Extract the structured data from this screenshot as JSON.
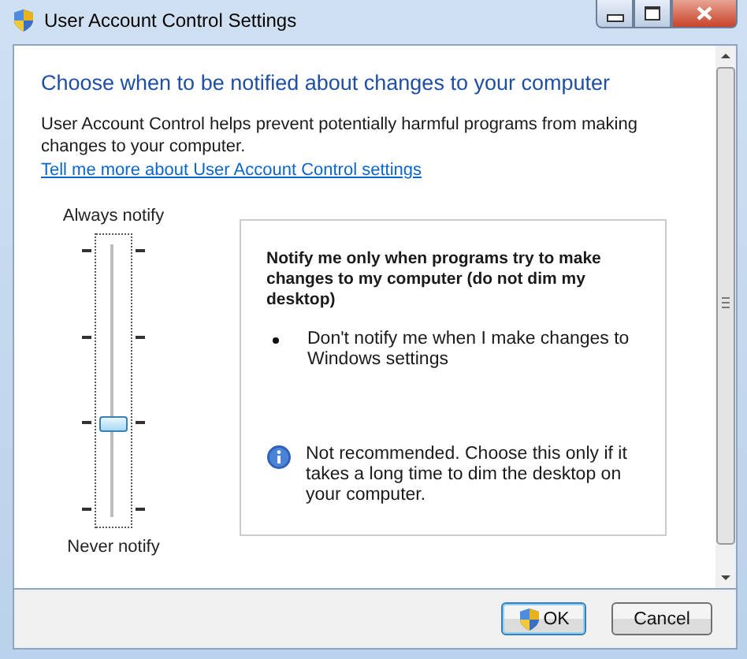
{
  "window": {
    "title": "User Account Control Settings"
  },
  "heading": "Choose when to be notified about changes to your computer",
  "description": "User Account Control helps prevent potentially harmful programs from making changes to your computer.",
  "help_link": "Tell me more about User Account Control settings",
  "slider": {
    "top_label": "Always notify",
    "bottom_label": "Never notify",
    "level": 0.3333
  },
  "details": {
    "title": "Notify me only when programs try to make changes to my computer (do not dim my desktop)",
    "bullets": [
      "Don't notify me when I make changes to Windows settings"
    ],
    "note": "Not recommended. Choose this only if it takes a long time to dim the desktop on your computer."
  },
  "buttons": [
    {
      "label": "OK",
      "kind": "shield",
      "default": true
    },
    {
      "label": "Cancel",
      "kind": "plain",
      "default": false
    }
  ]
}
